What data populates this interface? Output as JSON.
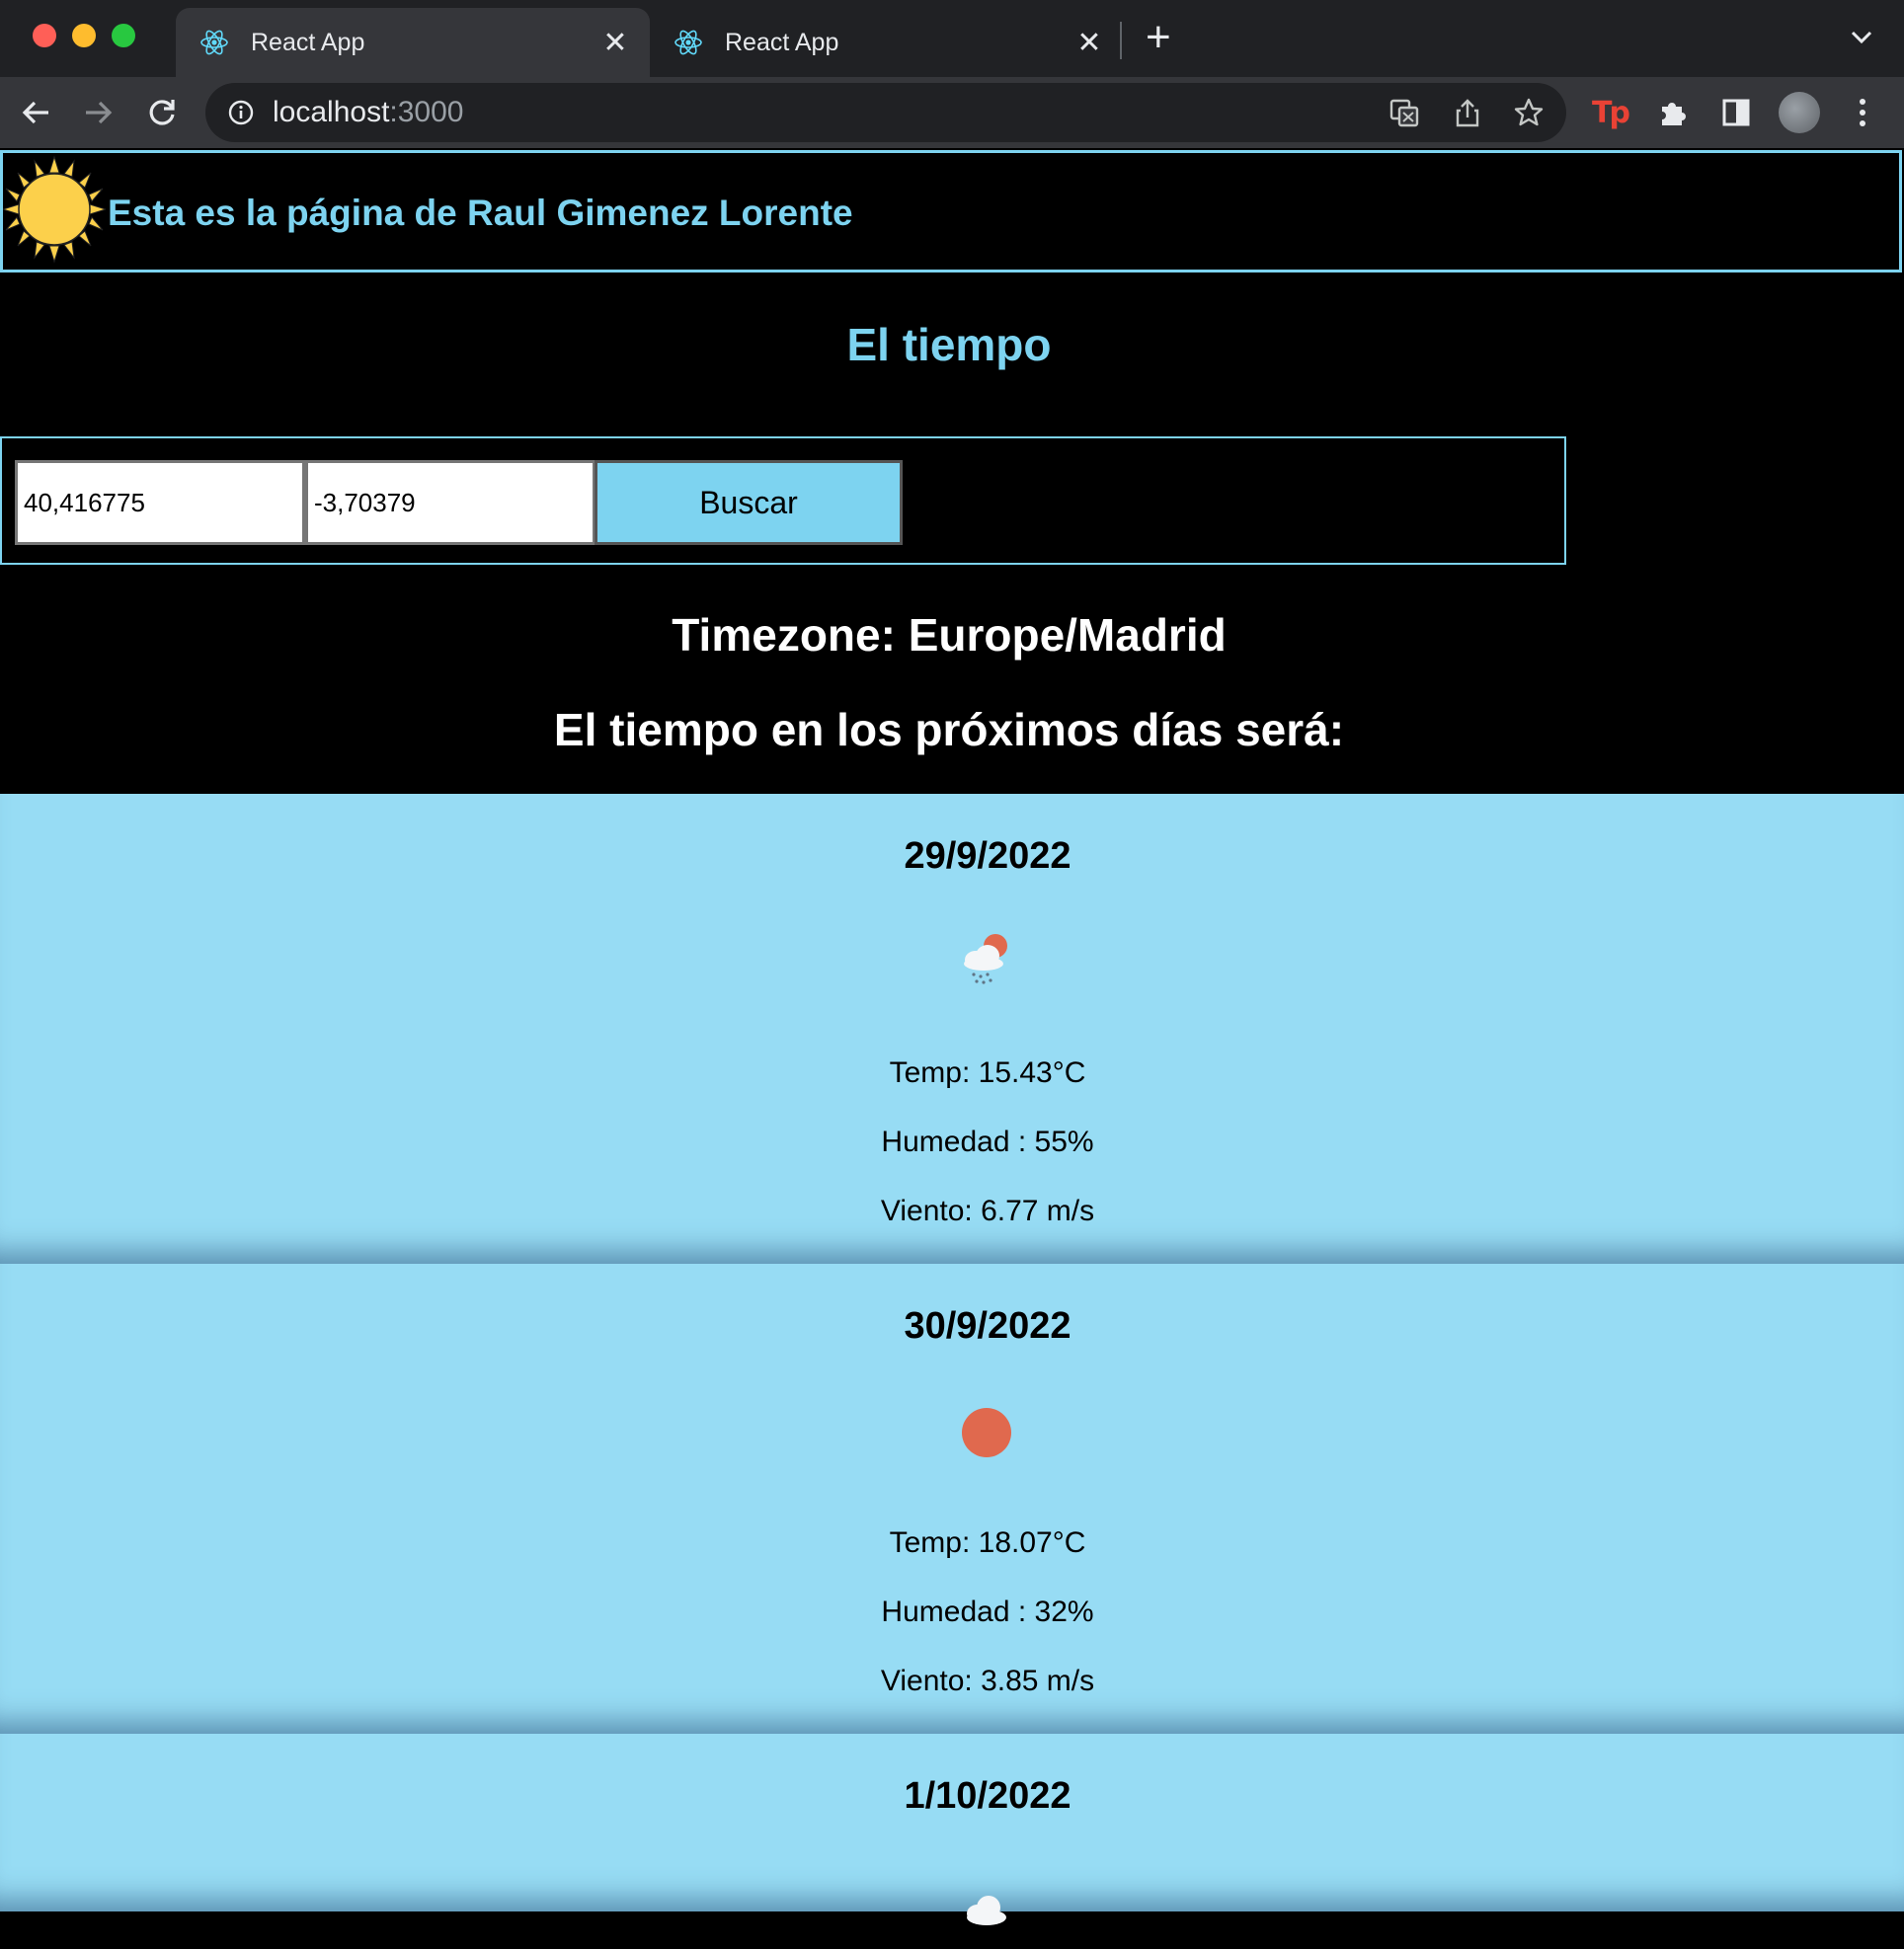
{
  "browser": {
    "tabs": [
      {
        "title": "React App",
        "active": true
      },
      {
        "title": "React App",
        "active": false
      }
    ],
    "url_host": "localhost",
    "url_port": ":3000"
  },
  "header": {
    "title": "Esta es la página de Raul Gimenez Lorente"
  },
  "page_title": "El tiempo",
  "search": {
    "lat_value": "40,416775",
    "lon_value": "-3,70379",
    "button_label": "Buscar"
  },
  "timezone": "Timezone: Europe/Madrid",
  "forecast_heading": "El tiempo en los próximos días será:",
  "forecast": [
    {
      "date": "29/9/2022",
      "icon": "rain-cloud-sun-icon",
      "temp": "Temp: 15.43°C",
      "humidity": "Humedad : 55%",
      "wind": "Viento: 6.77 m/s"
    },
    {
      "date": "30/9/2022",
      "icon": "sun-icon",
      "temp": "Temp: 18.07°C",
      "humidity": "Humedad : 32%",
      "wind": "Viento: 3.85 m/s"
    },
    {
      "date": "1/10/2022",
      "icon": "cloud-icon"
    }
  ],
  "colors": {
    "accent": "#7dd3f0",
    "card_bg": "#97dcf4",
    "sun": "#fcd04b",
    "weather_sun": "#e0694e"
  }
}
